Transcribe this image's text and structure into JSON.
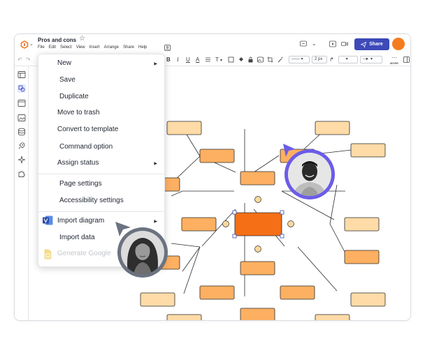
{
  "titlebar": {
    "doc_title": "Pros and cons",
    "menu": [
      "File",
      "Edit",
      "Select",
      "View",
      "Insert",
      "Arrange",
      "Share",
      "Help"
    ],
    "share_label": "Share"
  },
  "toolbar": {
    "bold": "B",
    "italic": "I",
    "underline": "U",
    "text_color": "A",
    "font_size": "T",
    "line_width": "2 px",
    "more_label": "MORE"
  },
  "context_menu": {
    "items": [
      {
        "label": "New",
        "has_submenu": true,
        "disabled": false
      },
      {
        "label": "Save",
        "has_submenu": false,
        "disabled": false
      },
      {
        "label": "Duplicate",
        "has_submenu": false,
        "disabled": false
      },
      {
        "label": "Move to trash",
        "has_submenu": false,
        "disabled": false
      },
      {
        "label": "Convert to template",
        "has_submenu": false,
        "disabled": false
      },
      {
        "label": "Command option",
        "has_submenu": false,
        "disabled": false
      },
      {
        "label": "Assign status",
        "has_submenu": true,
        "disabled": false
      },
      {
        "label": "Page settings",
        "has_submenu": false,
        "disabled": false
      },
      {
        "label": "Accessibility settings",
        "has_submenu": false,
        "disabled": false
      },
      {
        "label": "Import diagram",
        "has_submenu": true,
        "disabled": false
      },
      {
        "label": "Import data",
        "has_submenu": false,
        "disabled": false
      },
      {
        "label": "Generate Google",
        "has_submenu": false,
        "disabled": true
      }
    ]
  },
  "colors": {
    "accent": "#3d4ab8",
    "brand_orange": "#f47d1f",
    "node_center": "#f46f16",
    "node_mid": "#fdb061",
    "node_outer": "#fedba7",
    "connector": "#fbd89c",
    "collaborator_purple": "#6c5ce7",
    "collaborator_gray": "#6b7280"
  },
  "icons": {
    "logo": "lucid-logo-icon",
    "star": "star-icon",
    "share": "paper-plane-icon",
    "visio": "visio-icon",
    "google": "google-sheets-icon"
  }
}
